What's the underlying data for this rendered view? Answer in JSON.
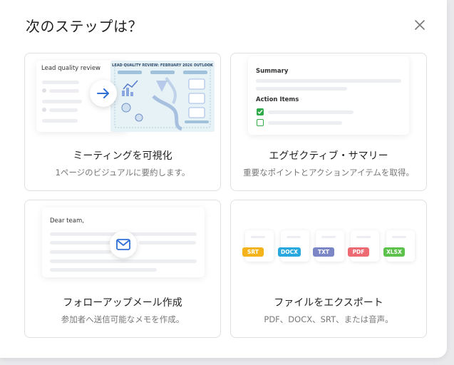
{
  "dialog": {
    "title": "次のステップは？",
    "close_icon": "close-icon"
  },
  "cards": [
    {
      "title": "ミーティングを可視化",
      "desc": "1ページのビジュアルに要約します。",
      "preview": {
        "doc_label": "Lead quality review",
        "infographic_title": "LEAD QUALITY REVIEW: FEBRUARY 2026 OUTLOOK",
        "arrow_icon": "arrow-right-icon"
      }
    },
    {
      "title": "エグゼクティブ・サマリー",
      "desc": "重要なポイントとアクションアイテムを取得。",
      "preview": {
        "summary_label": "Summary",
        "action_items_label": "Action Items",
        "accent": "#2eaa4a"
      }
    },
    {
      "title": "フォローアップメール作成",
      "desc": "参加者へ送信可能なメモを作成。",
      "preview": {
        "greeting": "Dear team,",
        "mail_icon": "mail-icon",
        "accent": "#2f6fd6"
      }
    },
    {
      "title": "ファイルをエクスポート",
      "desc": "PDF、DOCX、SRT、または音声。",
      "preview": {
        "formats": [
          {
            "label": "SRT",
            "color": "#f4b21b"
          },
          {
            "label": "DOCX",
            "color": "#29a8e0"
          },
          {
            "label": "TXT",
            "color": "#7a86c6"
          },
          {
            "label": "PDF",
            "color": "#ee6a72"
          },
          {
            "label": "XLSX",
            "color": "#5cc24c"
          }
        ]
      }
    }
  ]
}
